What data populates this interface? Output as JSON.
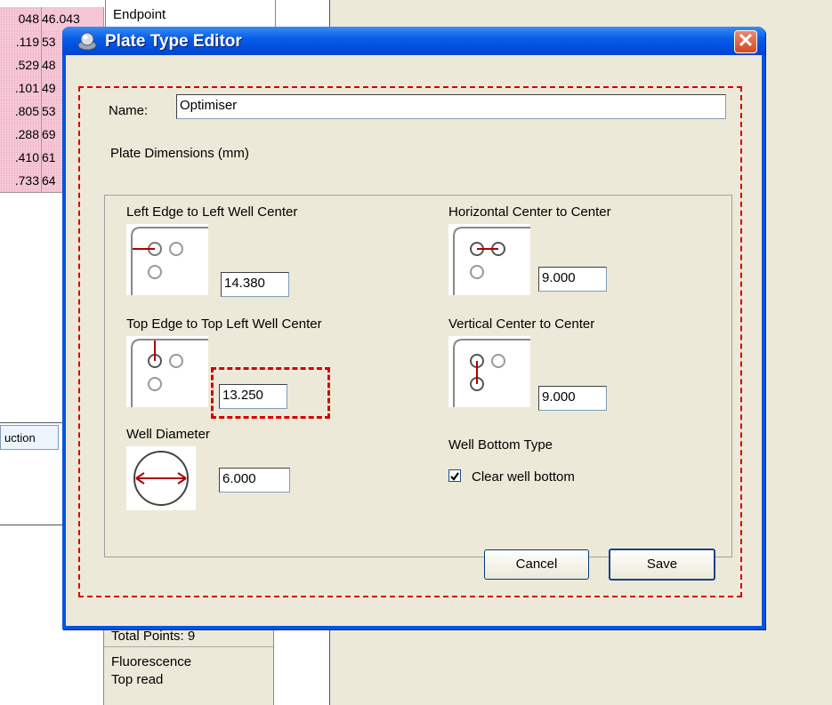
{
  "background_app": {
    "grid_rows": [
      {
        "col1": "048",
        "col2": "46.043"
      },
      {
        "col1": ".119",
        "col2": "53"
      },
      {
        "col1": ".529",
        "col2": "48"
      },
      {
        "col1": ".101",
        "col2": "49"
      },
      {
        "col1": ".805",
        "col2": "53"
      },
      {
        "col1": ".288",
        "col2": "69"
      },
      {
        "col1": ".410",
        "col2": "61"
      },
      {
        "col1": ".733",
        "col2": "64"
      }
    ],
    "endpoint_label": "Endpoint",
    "instruction_tab": "uction",
    "total_points": "Total Points: 9",
    "read_mode_line1": "Fluorescence",
    "read_mode_line2": "Top read"
  },
  "dialog": {
    "title": "Plate Type Editor",
    "close_label": "✕",
    "name_label": "Name:",
    "name_value": "Optimiser",
    "group_title": "Plate Dimensions (mm)",
    "left_edge": {
      "label": "Left Edge to Left Well Center",
      "value": "14.380"
    },
    "horizontal": {
      "label": "Horizontal Center to Center",
      "value": "9.000"
    },
    "top_edge": {
      "label": "Top Edge to Top Left Well Center",
      "value": "13.250"
    },
    "vertical": {
      "label": "Vertical Center to Center",
      "value": "9.000"
    },
    "well_diameter": {
      "label": "Well Diameter",
      "value": "6.000"
    },
    "well_bottom": {
      "label": "Well Bottom Type",
      "checkbox_label": "Clear well bottom",
      "checked": true
    },
    "cancel_label": "Cancel",
    "save_label": "Save"
  },
  "colors": {
    "title_blue": "#0054e3",
    "dialog_bg": "#ece9d8",
    "highlight_red": "#d40000",
    "diagram_red": "#b00000",
    "grid_pink": "#f6c6d6"
  }
}
